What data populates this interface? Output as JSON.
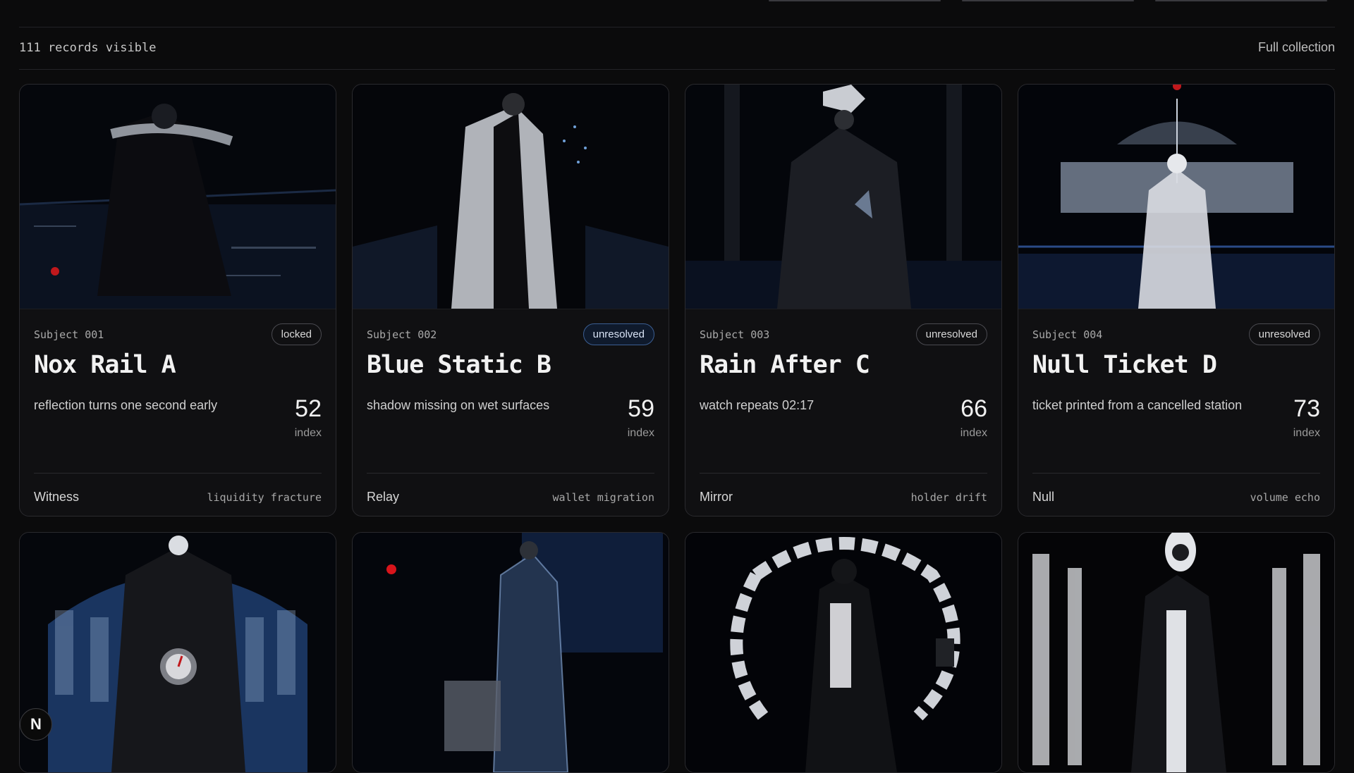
{
  "records": {
    "count_text": "111 records visible",
    "view_label": "Full collection"
  },
  "cards": [
    {
      "subject": "Subject 001",
      "badge": "locked",
      "title": "Nox Rail A",
      "desc": "reflection turns one second early",
      "index": "52",
      "index_label": "index",
      "role": "Witness",
      "tag": "liquidity fracture"
    },
    {
      "subject": "Subject 002",
      "badge": "unresolved",
      "title": "Blue Static B",
      "desc": "shadow missing on wet surfaces",
      "index": "59",
      "index_label": "index",
      "role": "Relay",
      "tag": "wallet migration"
    },
    {
      "subject": "Subject 003",
      "badge": "unresolved",
      "title": "Rain After C",
      "desc": "watch repeats 02:17",
      "index": "66",
      "index_label": "index",
      "role": "Mirror",
      "tag": "holder drift"
    },
    {
      "subject": "Subject 004",
      "badge": "unresolved",
      "title": "Null Ticket D",
      "desc": "ticket printed from a cancelled station",
      "index": "73",
      "index_label": "index",
      "role": "Null",
      "tag": "volume echo"
    }
  ],
  "floating_badge": "N",
  "colors": {
    "accent_blue": "#3b5e92",
    "background": "#0b0b0c",
    "card": "#101012"
  }
}
